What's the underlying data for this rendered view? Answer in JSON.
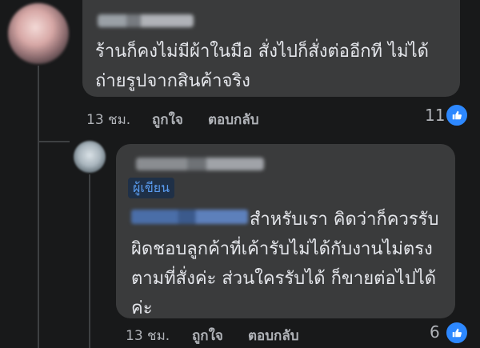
{
  "comment1": {
    "text": "ร้านก็คงไม่มีผ้าในมือ สั่งไปก็สั่งต่ออีกที ไม่ได้ถ่ายรูปจากสินค้าจริง",
    "time": "13 ชม.",
    "like_label": "ถูกใจ",
    "reply_label": "ตอบกลับ",
    "reaction_count": "11"
  },
  "comment2": {
    "author_badge": "ผู้เขียน",
    "text": "สำหรับเรา คิดว่าก็ควรรับผิดชอบลูกค้าที่เค้ารับไม่ได้กับงานไม่ตรงตามที่สั่งค่ะ ส่วนใครรับได้ ก็ขายต่อไปได้ค่ะ",
    "time": "13 ชม.",
    "like_label": "ถูกใจ",
    "reply_label": "ตอบกลับ",
    "reaction_count": "6"
  },
  "colors": {
    "background": "#18191a",
    "bubble": "#3a3b3c",
    "like_blue": "#2d88ff",
    "badge_text": "#5a9cf0"
  },
  "icons": {
    "reaction": "thumbs-up-icon"
  }
}
